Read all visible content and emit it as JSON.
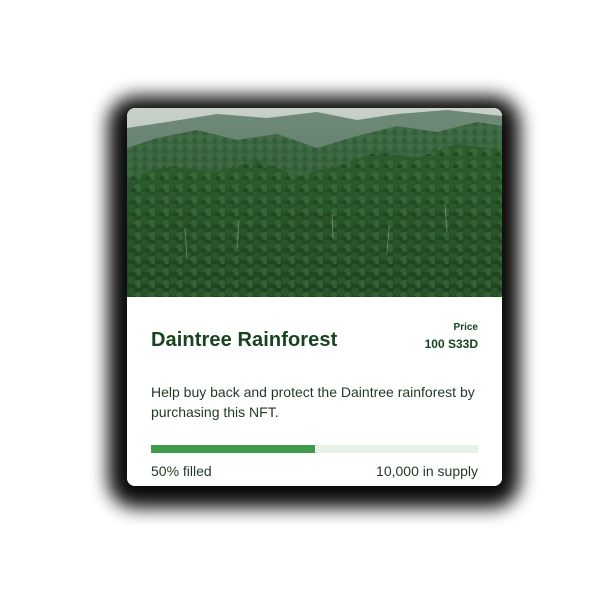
{
  "card": {
    "title": "Daintree Rainforest",
    "image_alt": "Daintree rainforest aerial view",
    "price": {
      "label": "Price",
      "value": "100 S33D"
    },
    "description": "Help buy back and protect the Daintree rainforest by purchasing this NFT.",
    "progress": {
      "fraction": 0.5,
      "filled_text": "50% filled",
      "supply_text": "10,000 in supply"
    },
    "colors": {
      "title": "#17441f",
      "progress_fill": "#3f9c4c",
      "progress_track": "#e6f1e8"
    }
  }
}
